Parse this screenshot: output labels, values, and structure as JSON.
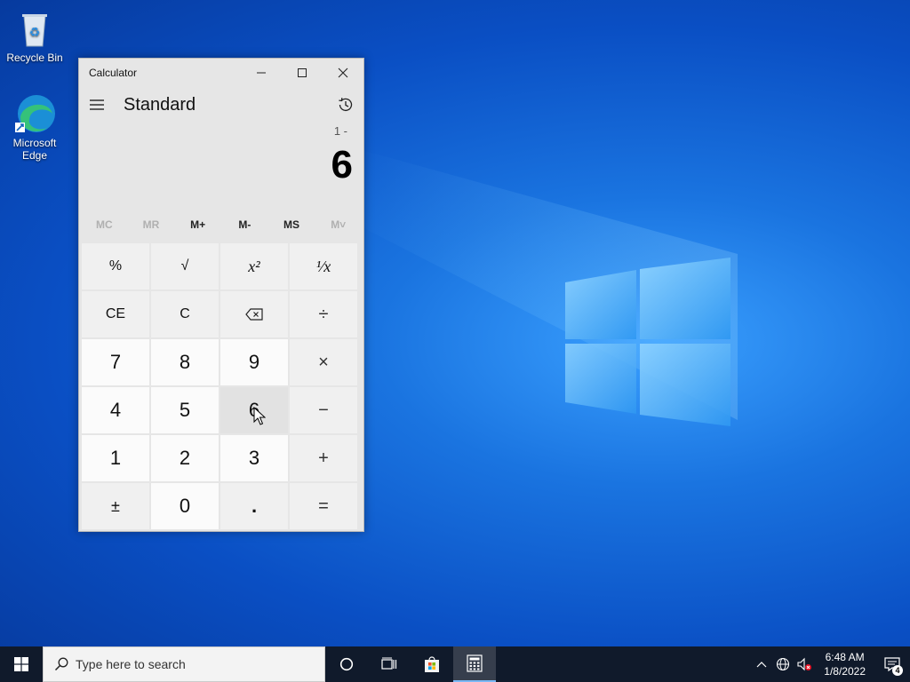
{
  "desktop": {
    "icons": [
      {
        "label": "Recycle Bin"
      },
      {
        "label": "Microsoft Edge"
      }
    ]
  },
  "calculator": {
    "title": "Calculator",
    "mode": "Standard",
    "expression": "1 -",
    "display": "6",
    "memory": [
      "MC",
      "MR",
      "M+",
      "M-",
      "MS",
      "M˅"
    ],
    "keys": [
      [
        "%",
        "√",
        "x²",
        "¹⁄x"
      ],
      [
        "CE",
        "C",
        "⌫",
        "÷"
      ],
      [
        "7",
        "8",
        "9",
        "×"
      ],
      [
        "4",
        "5",
        "6",
        "−"
      ],
      [
        "1",
        "2",
        "3",
        "+"
      ],
      [
        "±",
        "0",
        ".",
        "="
      ]
    ]
  },
  "taskbar": {
    "search_placeholder": "Type here to search",
    "time": "6:48 AM",
    "date": "1/8/2022",
    "notification_count": "4"
  }
}
